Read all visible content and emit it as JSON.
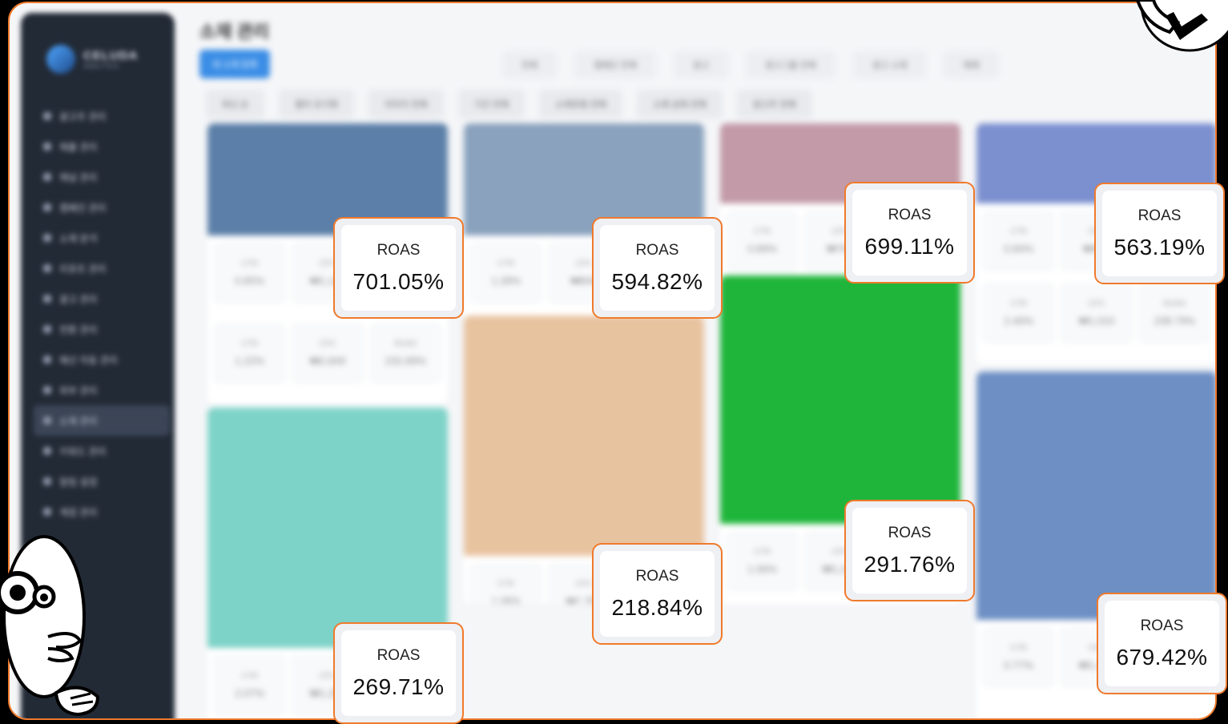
{
  "sidebar": {
    "logo_text": "CELUDA",
    "logo_sub": "ANALYTICS",
    "items": [
      {
        "label": "광고주 관리"
      },
      {
        "label": "매출 관리"
      },
      {
        "label": "채널 관리"
      },
      {
        "label": "캠페인 관리"
      },
      {
        "label": "소재 분석"
      },
      {
        "label": "리포트 관리"
      },
      {
        "label": "광고 관리"
      },
      {
        "label": "전환 관리"
      },
      {
        "label": "예산 자동 관리"
      },
      {
        "label": "외부 관리"
      },
      {
        "label": "소재 관리",
        "active": true
      },
      {
        "label": "키워드 관리"
      },
      {
        "label": "알림 설정"
      },
      {
        "label": "계정 관리"
      }
    ]
  },
  "header": {
    "title": "소재 관리",
    "primary_button": "새 소재 등록"
  },
  "filters": [
    "전체",
    "캠페인 전체",
    "광고",
    "광고그룹 전체",
    "광고 소재",
    "매체"
  ],
  "chips": [
    "최신 순",
    "필터 초기화",
    "이미지 전체",
    "기간 전체",
    "소재유형 전체",
    "소재 상태 전체",
    "광고주 전체"
  ],
  "cards": [
    {
      "metrics": [
        [
          "CTR",
          "0.85%"
        ],
        [
          "CPC",
          "₩1,120"
        ],
        [
          "ROAS",
          "701.05%"
        ]
      ],
      "img": "#5b7fa8"
    },
    {
      "metrics": [
        [
          "CTR",
          "1.28%"
        ],
        [
          "CPC",
          "₩840"
        ],
        [
          "ROAS",
          "594.82%"
        ]
      ],
      "img": "#8aa2bd"
    },
    {
      "metrics": [
        [
          "CTR",
          "0.89%"
        ],
        [
          "CPC",
          "₩760"
        ],
        [
          "ROAS",
          "699.11%"
        ]
      ],
      "img": "#c29aa8"
    },
    {
      "metrics": [
        [
          "CTR",
          "0.84%"
        ],
        [
          "CPC",
          "₩920"
        ],
        [
          "ROAS",
          "563.19%"
        ]
      ],
      "img": "#7c8fcf"
    },
    {
      "metrics": [
        [
          "CTR",
          "1.22%"
        ],
        [
          "CPC",
          "₩2,849"
        ],
        [
          "ROAS",
          "232.89%"
        ]
      ],
      "img": ""
    },
    {
      "metrics": [
        [
          "CTR",
          "2.46%"
        ],
        [
          "CPC",
          "₩1,010"
        ],
        [
          "ROAS",
          "238.79%"
        ]
      ],
      "img": ""
    },
    {
      "metrics": [
        [
          "CTR",
          "1.06%"
        ],
        [
          "CPC",
          "₩1,200"
        ],
        [
          "ROAS",
          "291.76%"
        ]
      ],
      "img": "#1eb53a"
    },
    {
      "metrics": [
        [
          "CTR",
          "1.08%"
        ],
        [
          "CPC",
          "₩1,350"
        ],
        [
          "ROAS",
          "218.84%"
        ]
      ],
      "img": "#e8c3a0"
    },
    {
      "metrics": [
        [
          "CTR",
          "2.07%"
        ],
        [
          "CPC",
          "₩1,290"
        ],
        [
          "ROAS",
          "269.71%"
        ]
      ],
      "img": "#7ed3c8"
    },
    {
      "metrics": [
        [
          "CTR",
          "0.77%"
        ],
        [
          "CPC",
          "₩1,480"
        ],
        [
          "ROAS",
          "679.42%"
        ]
      ],
      "img": "#6d8fc4"
    }
  ],
  "roas_badges": [
    {
      "label": "ROAS",
      "value": "701.05%"
    },
    {
      "label": "ROAS",
      "value": "594.82%"
    },
    {
      "label": "ROAS",
      "value": "699.11%"
    },
    {
      "label": "ROAS",
      "value": "563.19%"
    },
    {
      "label": "ROAS",
      "value": "291.76%"
    },
    {
      "label": "ROAS",
      "value": "218.84%"
    },
    {
      "label": "ROAS",
      "value": "269.71%"
    },
    {
      "label": "ROAS",
      "value": "679.42%"
    }
  ],
  "colors": {
    "accent": "#f07a2c",
    "sidebar_bg": "#222a36",
    "primary_button": "#3a8de6",
    "background": "#000000"
  },
  "icons": {
    "mascot_left": "magnifier-mascot-icon",
    "mascot_top": "peace-hand-icon"
  }
}
